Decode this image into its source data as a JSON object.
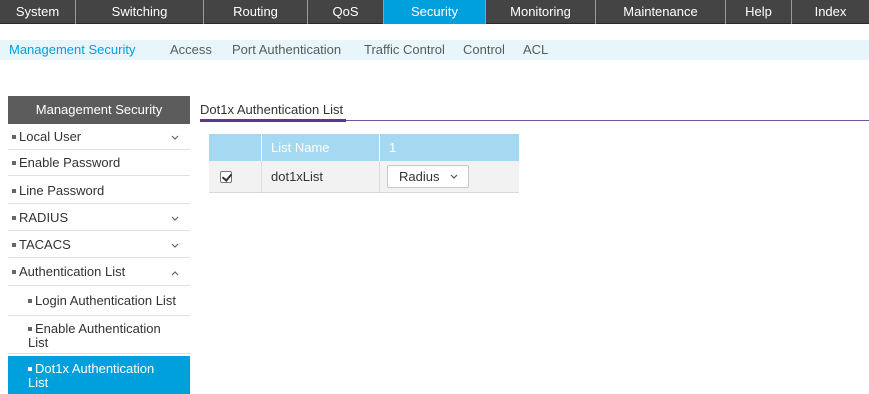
{
  "top_nav": {
    "tabs": [
      {
        "label": "System"
      },
      {
        "label": "Switching"
      },
      {
        "label": "Routing"
      },
      {
        "label": "QoS"
      },
      {
        "label": "Security"
      },
      {
        "label": "Monitoring"
      },
      {
        "label": "Maintenance"
      },
      {
        "label": "Help"
      },
      {
        "label": "Index"
      }
    ],
    "active": "Security",
    "accent_color": "#00a0dc",
    "bar_color": "#444444"
  },
  "sub_nav": {
    "items": [
      {
        "label": "Management Security"
      },
      {
        "label": "Access"
      },
      {
        "label": "Port Authentication"
      },
      {
        "label": "Traffic Control"
      },
      {
        "label": "Control"
      },
      {
        "label": "ACL"
      }
    ],
    "active": "Management Security"
  },
  "sidebar": {
    "title": "Management Security",
    "items": [
      {
        "label": "Local User",
        "icon": "chevron-down-icon"
      },
      {
        "label": "Enable Password",
        "icon": ""
      },
      {
        "label": "Line Password",
        "icon": ""
      },
      {
        "label": "RADIUS",
        "icon": "chevron-down-icon"
      },
      {
        "label": "TACACS",
        "icon": "chevron-down-icon"
      },
      {
        "label": "Authentication List",
        "icon": "chevron-up-icon"
      },
      {
        "label": "Login Authentication List",
        "icon": ""
      },
      {
        "label": "Enable Authentication List",
        "icon": ""
      },
      {
        "label": "Dot1x Authentication List",
        "icon": ""
      }
    ],
    "active": "Dot1x Authentication List"
  },
  "content": {
    "tab_label": "Dot1x Authentication List",
    "table": {
      "headers": [
        "",
        "List Name",
        "1"
      ],
      "rows": [
        {
          "checked": true,
          "list_name": "dot1xList",
          "method_1": "Radius"
        }
      ]
    }
  }
}
